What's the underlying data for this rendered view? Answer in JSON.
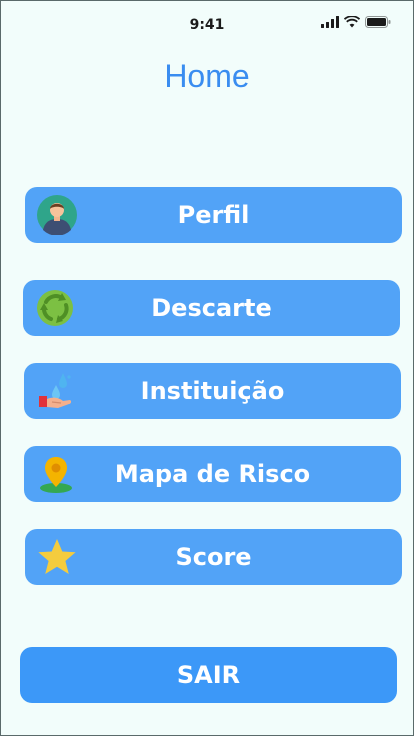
{
  "status_bar": {
    "time": "9:41"
  },
  "header": {
    "title": "Home"
  },
  "menu": {
    "items": [
      {
        "label": "Perfil",
        "icon": "user-avatar-icon"
      },
      {
        "label": "Descarte",
        "icon": "recycle-icon"
      },
      {
        "label": "Instituição",
        "icon": "water-hand-icon"
      },
      {
        "label": "Mapa de Risco",
        "icon": "map-pin-icon"
      },
      {
        "label": "Score",
        "icon": "star-icon"
      }
    ]
  },
  "logout": {
    "label": "SAIR"
  },
  "colors": {
    "background": "#f2fdfb",
    "title": "#3a8df0",
    "button": "#52a3f7",
    "logout_button": "#3c98f8",
    "button_text": "#ffffff"
  }
}
